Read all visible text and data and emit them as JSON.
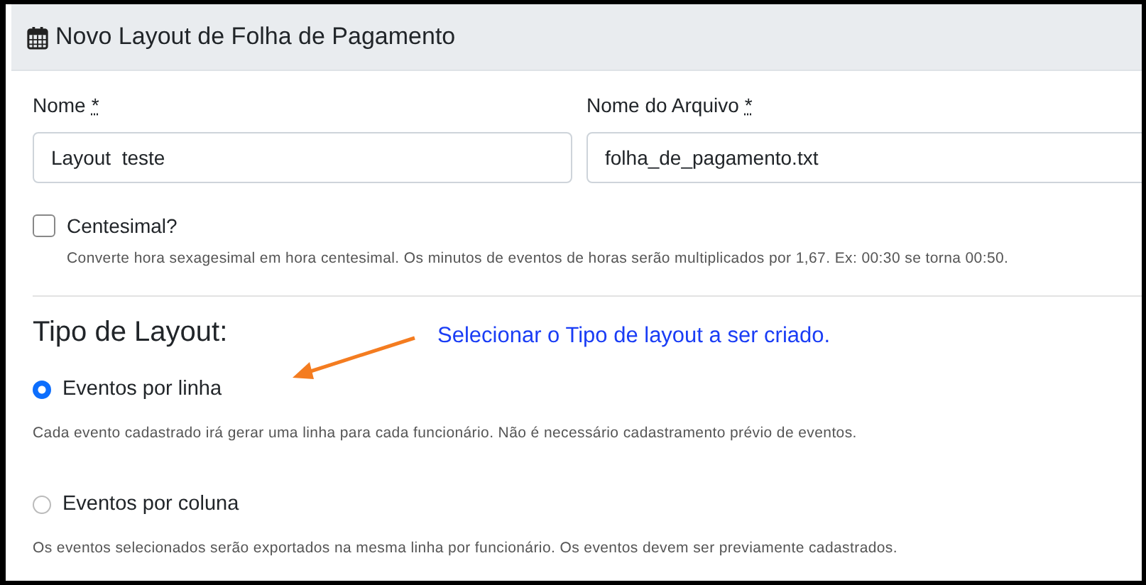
{
  "header": {
    "title": "Novo Layout de Folha de Pagamento"
  },
  "fields": [
    {
      "label": "Nome",
      "required_mark": "*",
      "value": "Layout  teste"
    },
    {
      "label": "Nome do Arquivo",
      "required_mark": "*",
      "value": "folha_de_pagamento.txt"
    }
  ],
  "centesimal": {
    "label": "Centesimal?",
    "checked": false,
    "help": "Converte hora sexagesimal em hora centesimal. Os minutos de eventos de horas serão multiplicados por 1,67. Ex: 00:30 se torna 00:50."
  },
  "layout_type": {
    "heading": "Tipo de Layout:",
    "options": [
      {
        "label": "Eventos por linha",
        "selected": true,
        "help": "Cada evento cadastrado irá gerar uma linha para cada funcionário. Não é necessário cadastramento prévio de eventos."
      },
      {
        "label": "Eventos por coluna",
        "selected": false,
        "help": "Os eventos selecionados serão exportados na mesma linha por funcionário. Os eventos devem ser previamente cadastrados."
      }
    ]
  },
  "annotation": {
    "text": "Selecionar o Tipo de layout a ser criado."
  }
}
